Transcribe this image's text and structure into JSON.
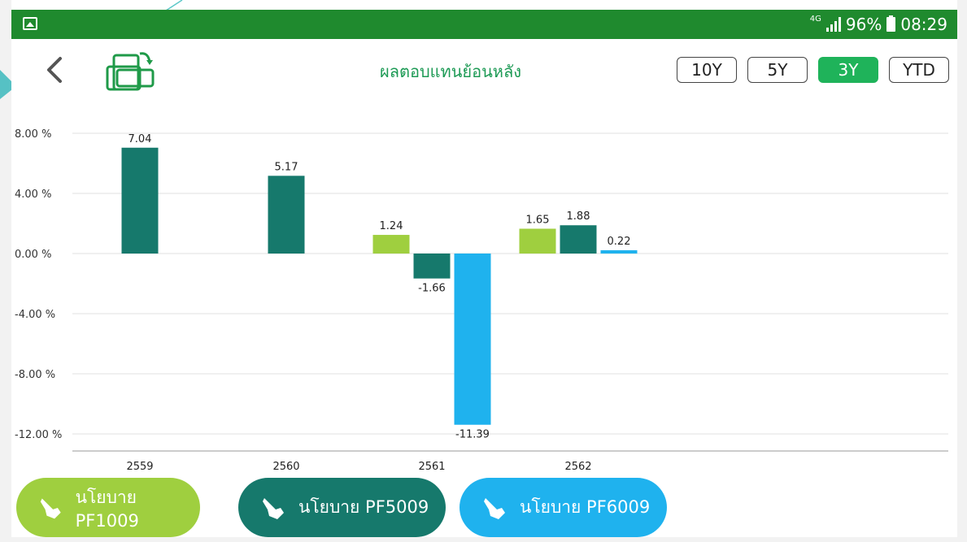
{
  "statusbar": {
    "network": "4G",
    "battery": "96%",
    "time": "08:29",
    "color": "#1f8a2e"
  },
  "toolbar": {
    "title": "ผลตอบแทนย้อนหลัง",
    "back_icon": "chevron-left-icon",
    "rotate_icon": "rotate-screen-icon",
    "ranges": [
      {
        "label": "10Y",
        "active": false
      },
      {
        "label": "5Y",
        "active": false
      },
      {
        "label": "3Y",
        "active": true
      },
      {
        "label": "YTD",
        "active": false
      }
    ],
    "accent": "#1fb35a"
  },
  "chart_data": {
    "type": "bar",
    "categories": [
      "2559",
      "2560",
      "2561",
      "2562"
    ],
    "ylim": [
      -12,
      8
    ],
    "yticks": [
      "8.00 %",
      "4.00 %",
      "0.00 %",
      "-4.00 %",
      "-8.00 %",
      "-12.00 %"
    ],
    "ytick_values": [
      8,
      4,
      0,
      -4,
      -8,
      -12
    ],
    "series": [
      {
        "name": "นโยบาย PF1009",
        "color": "#9fcf3f",
        "values": [
          null,
          null,
          1.24,
          1.65
        ]
      },
      {
        "name": "นโยบาย PF5009",
        "color": "#16796c",
        "values": [
          7.04,
          5.17,
          -1.66,
          1.88
        ]
      },
      {
        "name": "นโยบาย PF6009",
        "color": "#1fb2ee",
        "values": [
          null,
          null,
          -11.39,
          0.22
        ]
      }
    ],
    "data_labels": [
      "7.04",
      "5.17",
      "1.24",
      "-1.66",
      "-11.39",
      "1.65",
      "1.88",
      "0.22"
    ]
  },
  "legend": {
    "items": [
      {
        "label": "นโยบาย PF1009",
        "color": "#9fcf3f",
        "icon": "hand-pointer-icon"
      },
      {
        "label": "นโยบาย PF5009",
        "color": "#16796c",
        "icon": "hand-pointer-icon"
      },
      {
        "label": "นโยบาย PF6009",
        "color": "#1fb2ee",
        "icon": "hand-pointer-icon"
      }
    ]
  }
}
